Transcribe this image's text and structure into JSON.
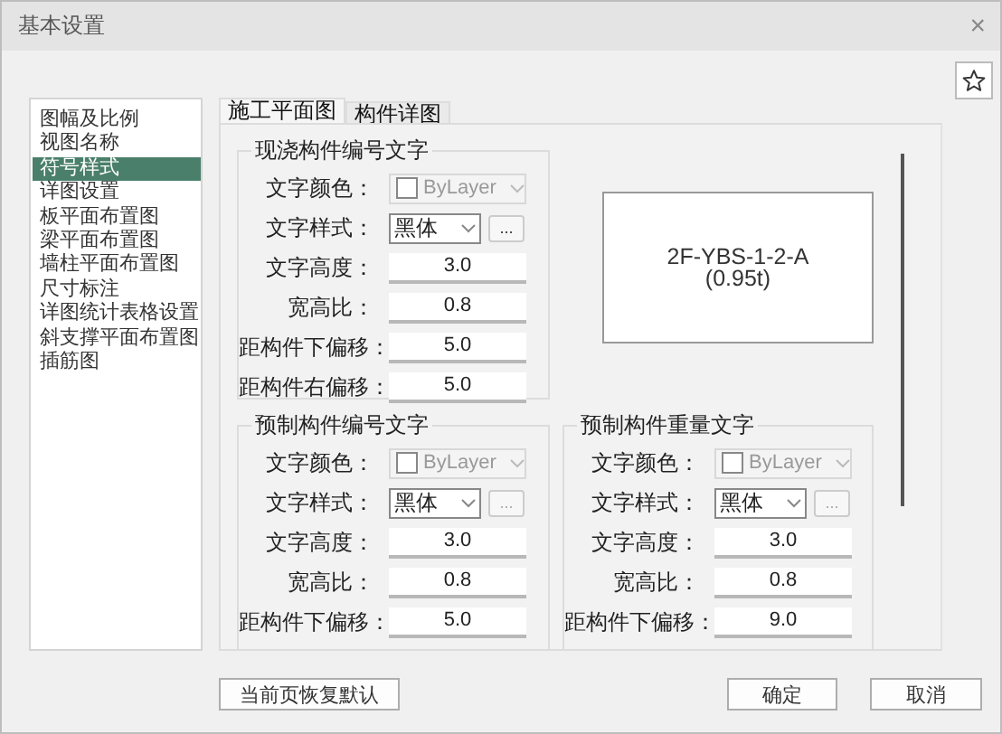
{
  "window": {
    "title": "基本设置",
    "close": "×"
  },
  "sidebar": {
    "items": [
      {
        "label": "图幅及比例",
        "selected": false
      },
      {
        "label": "视图名称",
        "selected": false
      },
      {
        "label": "符号样式",
        "selected": true
      },
      {
        "label": "详图设置",
        "selected": false
      },
      {
        "label": "板平面布置图",
        "selected": false
      },
      {
        "label": "梁平面布置图",
        "selected": false
      },
      {
        "label": "墙柱平面布置图",
        "selected": false
      },
      {
        "label": "尺寸标注",
        "selected": false
      },
      {
        "label": "详图统计表格设置",
        "selected": false
      },
      {
        "label": "斜支撑平面布置图",
        "selected": false
      },
      {
        "label": "插筋图",
        "selected": false
      }
    ]
  },
  "tabs": [
    {
      "label": "施工平面图",
      "selected": true
    },
    {
      "label": "构件详图",
      "selected": false
    }
  ],
  "groups": [
    {
      "title": "现浇构件编号文字",
      "rows": [
        {
          "kind": "color",
          "label": "文字颜色：",
          "value": "ByLayer",
          "disabled": true
        },
        {
          "kind": "style",
          "label": "文字样式：",
          "value": "黑体",
          "more": "...",
          "more_disabled": false
        },
        {
          "kind": "number",
          "label": "文字高度：",
          "value": "3.0"
        },
        {
          "kind": "number",
          "label": "宽高比：",
          "value": "0.8"
        },
        {
          "kind": "number",
          "label": "距构件下偏移：",
          "value": "5.0"
        },
        {
          "kind": "number",
          "label": "距构件右偏移：",
          "value": "5.0"
        }
      ]
    },
    {
      "title": "预制构件编号文字",
      "rows": [
        {
          "kind": "color",
          "label": "文字颜色：",
          "value": "ByLayer",
          "disabled": true
        },
        {
          "kind": "style",
          "label": "文字样式：",
          "value": "黑体",
          "more": "...",
          "more_disabled": true
        },
        {
          "kind": "number",
          "label": "文字高度：",
          "value": "3.0"
        },
        {
          "kind": "number",
          "label": "宽高比：",
          "value": "0.8"
        },
        {
          "kind": "number",
          "label": "距构件下偏移：",
          "value": "5.0"
        }
      ]
    },
    {
      "title": "预制构件重量文字",
      "rows": [
        {
          "kind": "color",
          "label": "文字颜色：",
          "value": "ByLayer",
          "disabled": true
        },
        {
          "kind": "style",
          "label": "文字样式：",
          "value": "黑体",
          "more": "...",
          "more_disabled": true
        },
        {
          "kind": "number",
          "label": "文字高度：",
          "value": "3.0"
        },
        {
          "kind": "number",
          "label": "宽高比：",
          "value": "0.8"
        },
        {
          "kind": "number",
          "label": "距构件下偏移：",
          "value": "9.0"
        }
      ]
    }
  ],
  "preview": {
    "lines": [
      "2F-YBS-1-2-A",
      "(0.95t)"
    ]
  },
  "reset_button": "当前页恢复默认",
  "buttons": [
    "确定",
    "取消"
  ]
}
